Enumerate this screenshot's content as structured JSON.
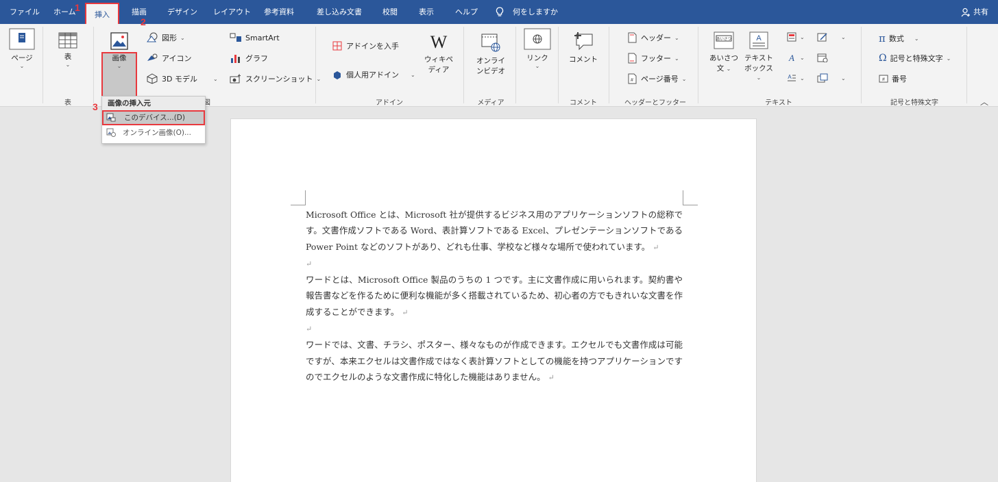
{
  "tabs": [
    {
      "label": "ファイル"
    },
    {
      "label": "ホーム"
    },
    {
      "label": "挿入"
    },
    {
      "label": "描画"
    },
    {
      "label": "デザイン"
    },
    {
      "label": "レイアウト"
    },
    {
      "label": "参考資料"
    },
    {
      "label": "差し込み文書"
    },
    {
      "label": "校閲"
    },
    {
      "label": "表示"
    },
    {
      "label": "ヘルプ"
    },
    {
      "label": "何をしますか"
    }
  ],
  "share_label": "共有",
  "ribbon": {
    "page_label": "ページ",
    "table_label": "表",
    "image_label": "画像",
    "shapes_label": "図形",
    "icons_label": "アイコン",
    "models3d_label": "3D モデル",
    "smartart_label": "SmartArt",
    "chart_label": "グラフ",
    "screenshot_label": "スクリーンショット",
    "get_addins_label": "アドインを入手",
    "my_addins_label": "個人用アドイン",
    "wikipedia_label_1": "ウィキペ",
    "wikipedia_label_2": "ディア",
    "online_video_label_1": "オンライ",
    "online_video_label_2": "ンビデオ",
    "link_label": "リンク",
    "comment_label": "コメント",
    "header_label": "ヘッダー",
    "footer_label": "フッター",
    "page_number_label": "ページ番号",
    "greeting_label_1": "あいさつ",
    "greeting_label_2": "文",
    "greeting_icon_text": "あいさつ",
    "textbox_label_1": "テキスト",
    "textbox_label_2": "ボックス",
    "equation_label": "数式",
    "symbol_label": "記号と特殊文字",
    "number_label": "番号",
    "groups": {
      "tables": "表",
      "illustrations": "図",
      "addins": "アドイン",
      "media": "メディア",
      "comments": "コメント",
      "header_footer": "ヘッダーとフッター",
      "text": "テキスト",
      "symbols": "記号と特殊文字"
    }
  },
  "dropdown": {
    "header": "画像の挿入元",
    "this_device": "このデバイス...(D)",
    "online_images": "オンライン画像(O)..."
  },
  "steps": [
    "1",
    "2",
    "3"
  ],
  "document": {
    "paragraphs": [
      "Microsoft Office とは、Microsoft 社が提供するビジネス用のアプリケーションソフトの総称です。文書作成ソフトである Word、表計算ソフトである Excel、プレゼンテーションソフトである Power Point などのソフトがあり、どれも仕事、学校など様々な場所で使われています。",
      "",
      "ワードとは、Microsoft Office 製品のうちの 1 つです。主に文書作成に用いられます。契約書や報告書などを作るために便利な機能が多く搭載されているため、初心者の方でもきれいな文書を作成することができます。",
      "",
      "ワードでは、文書、チラシ、ポスター、様々なものが作成できます。エクセルでも文書作成は可能ですが、本来エクセルは文書作成ではなく表計算ソフトとしての機能を持つアプリケーションですのでエクセルのような文書作成に特化した機能はありません。"
    ],
    "return_mark": "↵"
  },
  "colors": {
    "tabbar": "#2b579a",
    "highlight_red": "#e8383d",
    "ribbon_bg": "#f3f3f3"
  }
}
